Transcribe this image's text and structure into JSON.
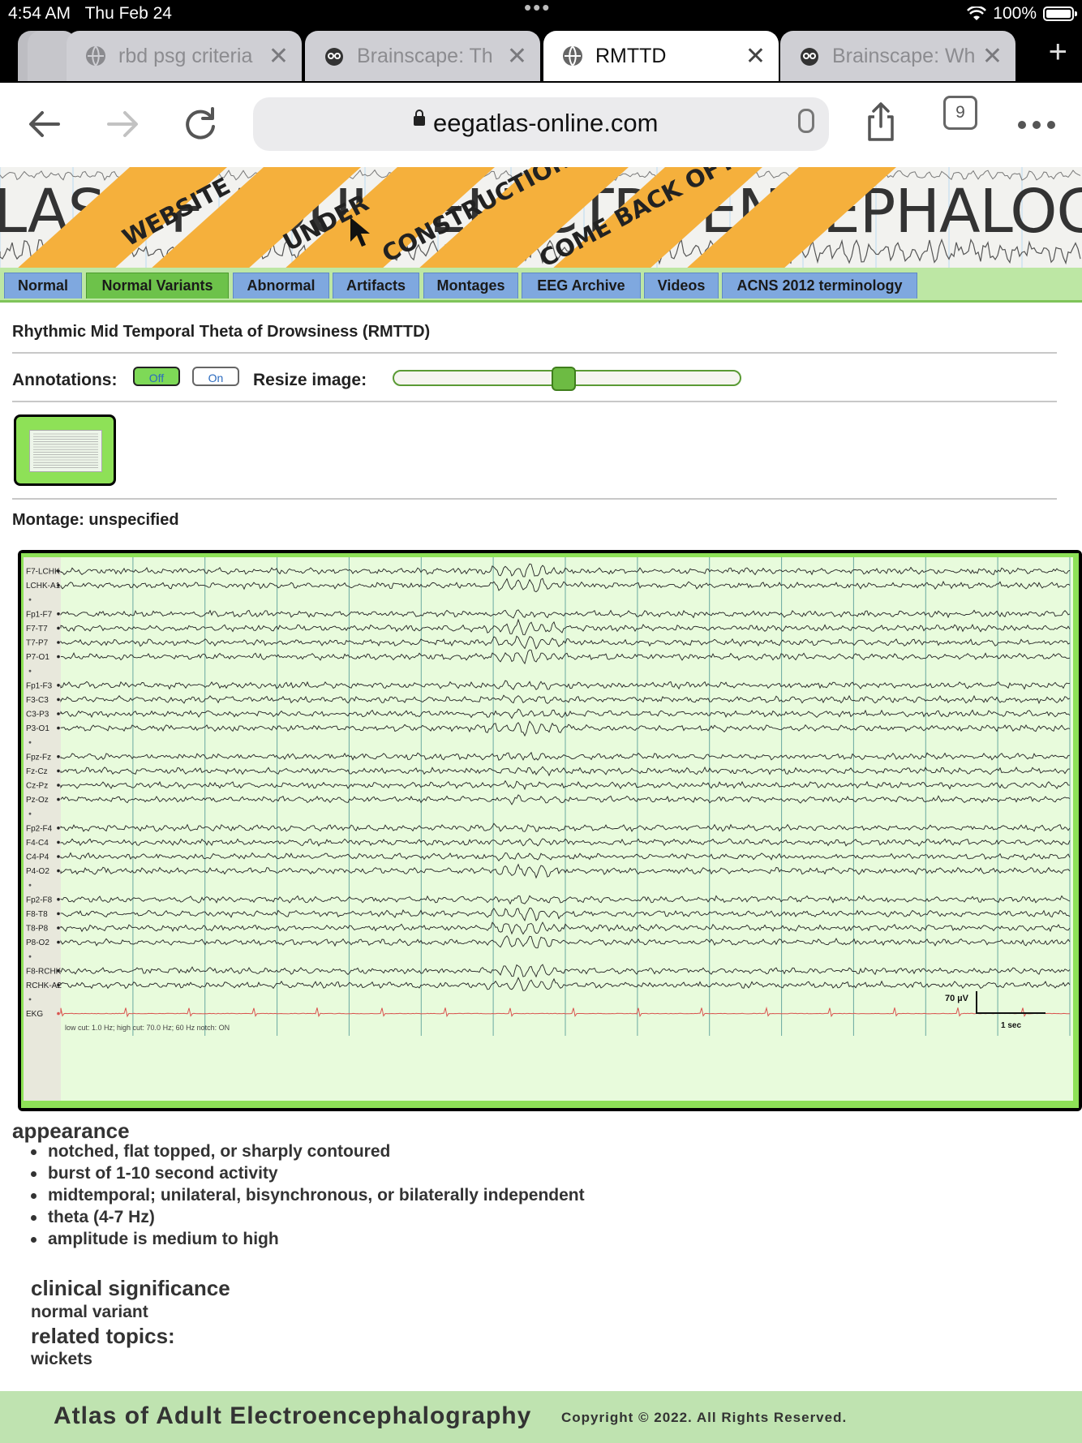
{
  "status_bar": {
    "time": "4:54 AM",
    "date": "Thu Feb 24",
    "battery": "100%"
  },
  "browser": {
    "tabs": [
      {
        "title": "rbd psg criteria",
        "icon": "globe-icon",
        "active": false
      },
      {
        "title": "Brainscape: Th",
        "icon": "brainscape-icon",
        "active": false
      },
      {
        "title": "RMTTD",
        "icon": "globe-icon",
        "active": true
      },
      {
        "title": "Brainscape: Wh",
        "icon": "brainscape-icon",
        "active": false
      }
    ],
    "url": "eegatlas-online.com",
    "tab_count": "9"
  },
  "banner": {
    "title": "LAS OF ADULT ELECTROENCEPHALOGRAPHY",
    "stripes": [
      "WEBSITE",
      "UNDER",
      "CONSTRUCTION",
      "COME BACK OFTEN!"
    ]
  },
  "nav": {
    "tabs": [
      "Normal",
      "Normal Variants",
      "Abnormal",
      "Artifacts",
      "Montages",
      "EEG Archive",
      "Videos",
      "ACNS 2012 terminology"
    ],
    "active": "Normal Variants"
  },
  "page": {
    "title": "Rhythmic Mid Temporal Theta of Drowsiness (RMTTD)",
    "annotations_label": "Annotations:",
    "annotations_off": "Off",
    "annotations_on": "On",
    "resize_label": "Resize image:",
    "resize_value": 0.5,
    "montage_label": "Montage: unspecified"
  },
  "eeg": {
    "channels": [
      "F7-LCHK",
      "LCHK-A1",
      "",
      "Fp1-F7",
      "F7-T7",
      "T7-P7",
      "P7-O1",
      "",
      "Fp1-F3",
      "F3-C3",
      "C3-P3",
      "P3-O1",
      "",
      "Fpz-Fz",
      "Fz-Cz",
      "Cz-Pz",
      "Pz-Oz",
      "",
      "Fp2-F4",
      "F4-C4",
      "C4-P4",
      "P4-O2",
      "",
      "Fp2-F8",
      "F8-T8",
      "T8-P8",
      "P8-O2",
      "",
      "F8-RCHK",
      "RCHK-A2",
      "",
      "EKG"
    ],
    "filter_text": "low cut: 1.0 Hz; high cut: 70.0 Hz; 60 Hz notch: ON",
    "scale_amplitude": "70 µV",
    "scale_time": "1 sec",
    "seconds": 14,
    "trace_color": "#222222",
    "ekg_color": "#d9534f",
    "background": "#e8fbdc"
  },
  "appearance": {
    "heading": "appearance",
    "items": [
      "notched, flat topped, or sharply contoured",
      "burst of 1-10 second activity",
      "midtemporal; unilateral, bisynchronous, or bilaterally independent",
      "theta (4-7 Hz)",
      "amplitude is medium to high"
    ]
  },
  "clinical": {
    "heading": "clinical significance",
    "text": "normal variant"
  },
  "related": {
    "heading": "related topics:",
    "text": "wickets"
  },
  "footer": {
    "title": "Atlas of Adult Electroencephalography",
    "copyright": "Copyright © 2022. All Rights Reserved."
  }
}
